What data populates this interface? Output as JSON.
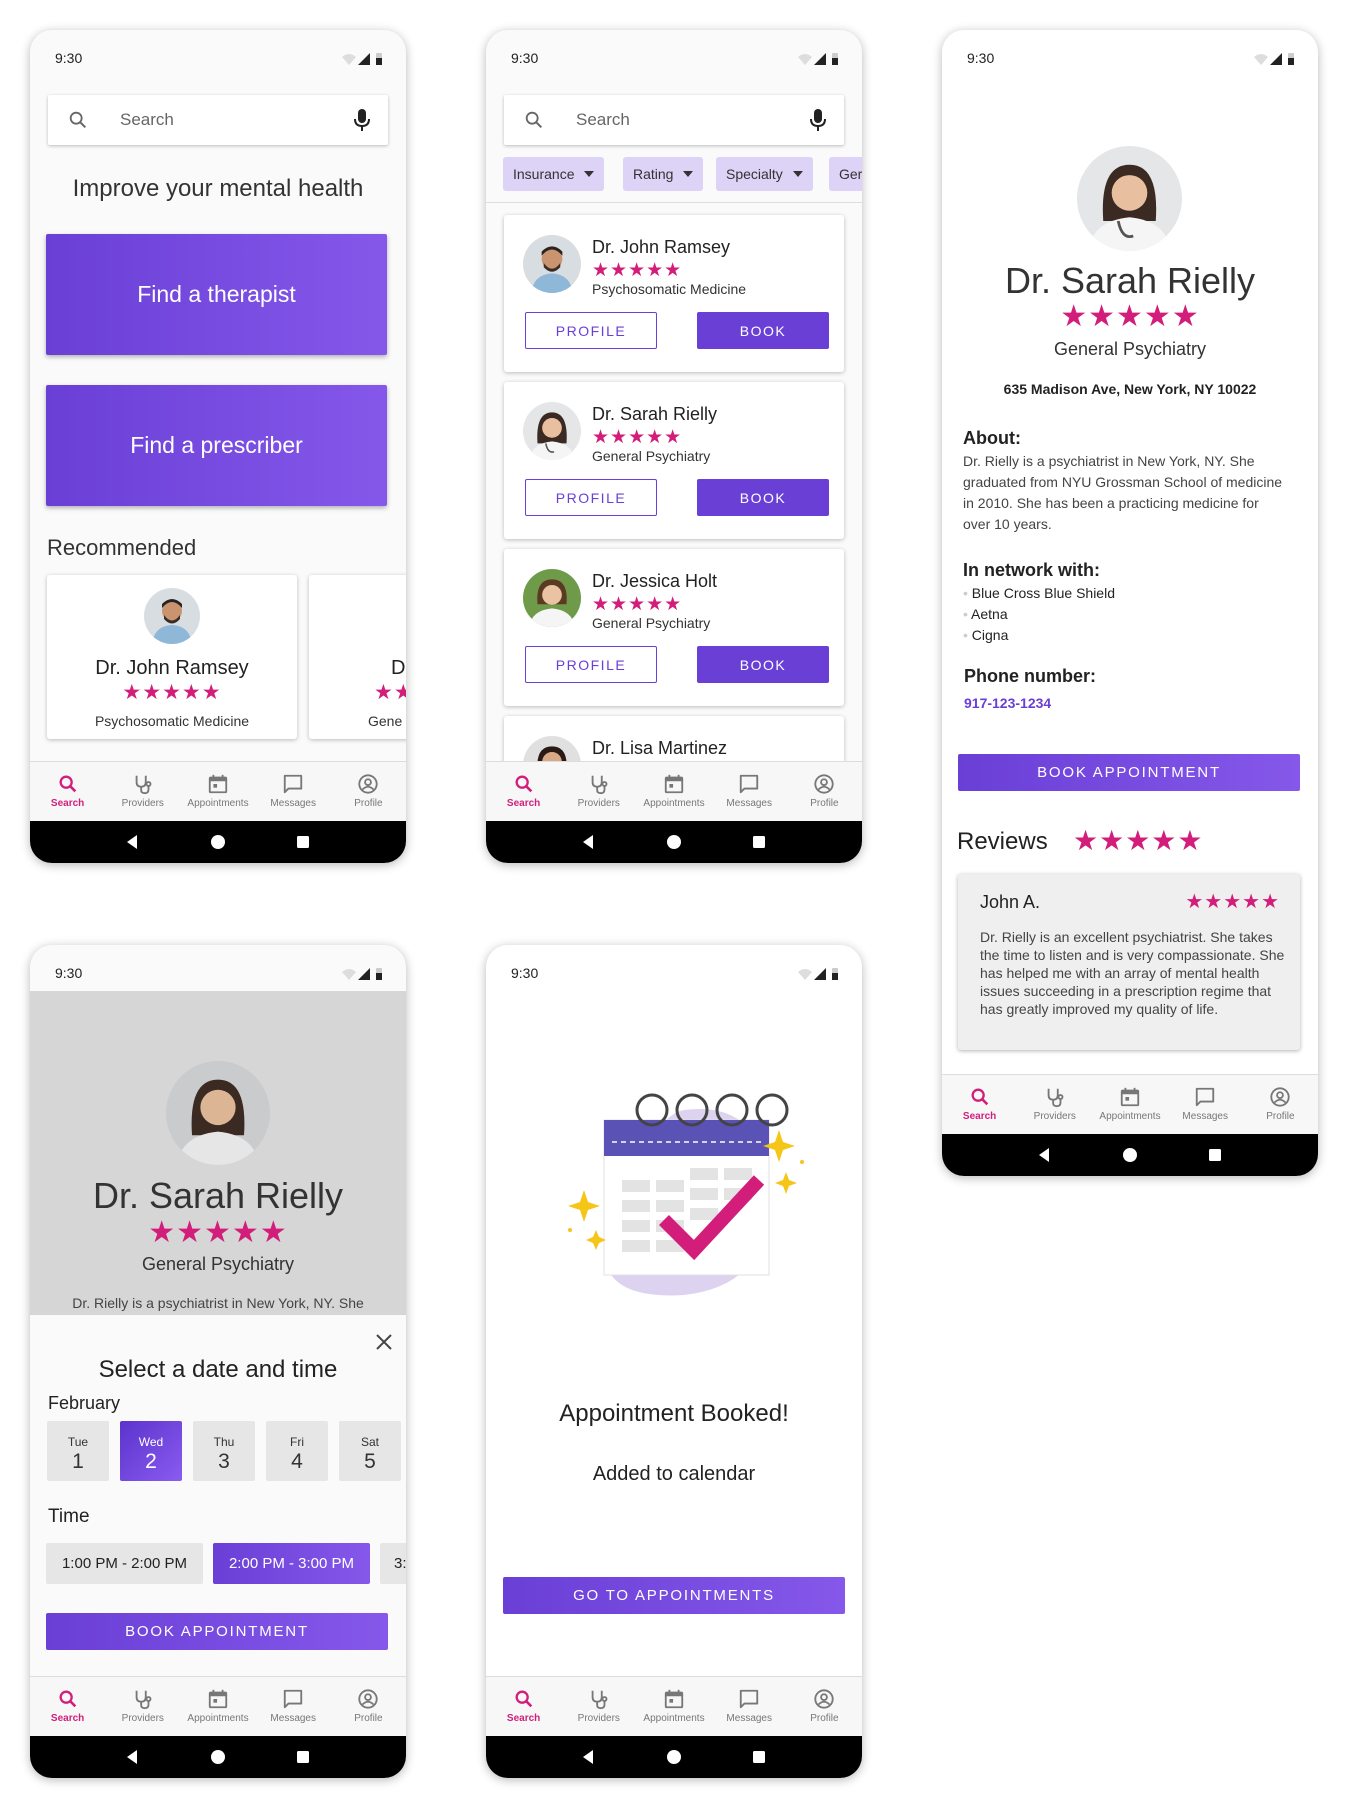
{
  "status": {
    "time": "9:30"
  },
  "search": {
    "placeholder": "Search"
  },
  "nav": {
    "items": [
      {
        "label": "Search",
        "icon": "search-icon"
      },
      {
        "label": "Providers",
        "icon": "stethoscope-icon"
      },
      {
        "label": "Appointments",
        "icon": "calendar-icon"
      },
      {
        "label": "Messages",
        "icon": "chat-icon"
      },
      {
        "label": "Profile",
        "icon": "profile-icon"
      }
    ]
  },
  "colors": {
    "primary": "#6a3fd6",
    "accent": "#d21e7a",
    "chip": "#dcd3f7"
  },
  "stars": "★★★★★",
  "home": {
    "heading": "Improve your mental health",
    "find_therapist": "Find a therapist",
    "find_prescriber": "Find a prescriber",
    "recommended": "Recommended",
    "cards": [
      {
        "name": "Dr. John Ramsey",
        "specialty": "Psychosomatic Medicine"
      },
      {
        "name": "Dr",
        "specialty": "Gene"
      }
    ]
  },
  "results": {
    "filters": [
      "Insurance",
      "Rating",
      "Specialty",
      "Ger"
    ],
    "profile_label": "PROFILE",
    "book_label": "BOOK",
    "providers": [
      {
        "name": "Dr. John Ramsey",
        "specialty": "Psychosomatic Medicine"
      },
      {
        "name": "Dr. Sarah Rielly",
        "specialty": "General Psychiatry"
      },
      {
        "name": "Dr. Jessica Holt",
        "specialty": "General Psychiatry"
      },
      {
        "name": "Dr. Lisa Martinez",
        "specialty": ""
      }
    ]
  },
  "profile": {
    "name": "Dr. Sarah Rielly",
    "specialty": "General Psychiatry",
    "address": "635 Madison Ave, New York, NY 10022",
    "about_title": "About:",
    "about_text": "Dr. Rielly is a psychiatrist in New York, NY. She graduated from NYU Grossman School of medicine in 2010. She has been a practicing medicine for over 10 years.",
    "network_title": "In network with:",
    "networks": [
      "Blue Cross Blue Shield",
      "Aetna",
      "Cigna"
    ],
    "phone_title": "Phone number:",
    "phone": "917-123-1234",
    "book_label": "BOOK APPOINTMENT",
    "reviews_title": "Reviews",
    "review": {
      "author": "John A.",
      "text": "Dr. Rielly is an excellent psychiatrist. She takes the time to listen and is very compassionate. She has helped me with an array of mental health issues succeeding in a prescription regime that has greatly improved my quality of life."
    }
  },
  "booking": {
    "behind_text": "Dr. Rielly is a psychiatrist in New York, NY. She",
    "title": "Select a date and time",
    "month": "February",
    "days": [
      {
        "dow": "Tue",
        "date": "1"
      },
      {
        "dow": "Wed",
        "date": "2"
      },
      {
        "dow": "Thu",
        "date": "3"
      },
      {
        "dow": "Fri",
        "date": "4"
      },
      {
        "dow": "Sat",
        "date": "5"
      }
    ],
    "time_label": "Time",
    "slots": [
      "1:00 PM - 2:00 PM",
      "2:00 PM - 3:00 PM",
      "3:"
    ],
    "book_label": "BOOK APPOINTMENT"
  },
  "confirm": {
    "title": "Appointment Booked!",
    "subtitle": "Added to calendar",
    "button": "GO TO APPOINTMENTS"
  }
}
